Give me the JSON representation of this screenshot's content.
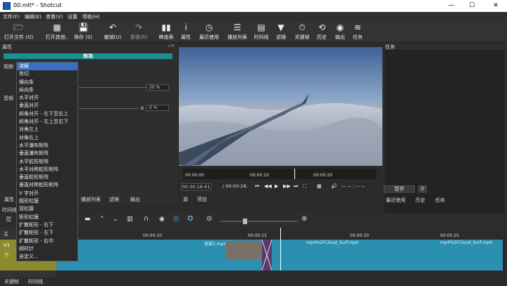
{
  "window": {
    "title": "00.mlt* - Shotcut",
    "minimize": "—",
    "maximize": "☐",
    "close": "✕"
  },
  "menu": [
    "文件(F)",
    "编辑(E)",
    "查看(V)",
    "设置",
    "帮助(H)"
  ],
  "toolbar": [
    {
      "label": "打开文件 (O)",
      "icon": "folder-open-icon",
      "glyph": "🗁"
    },
    {
      "label": "打开其他..",
      "icon": "open-other-icon",
      "glyph": "▦"
    },
    {
      "label": "保存 (S)",
      "icon": "save-icon",
      "glyph": "💾"
    },
    {
      "label": "撤销(U)",
      "icon": "undo-icon",
      "glyph": "↶"
    },
    {
      "label": "重做(R)",
      "icon": "redo-icon",
      "glyph": "↷"
    },
    {
      "label": "峰值表",
      "icon": "peak-meter-icon",
      "glyph": "▮▮"
    },
    {
      "label": "属性",
      "icon": "info-icon",
      "glyph": "ⅰ"
    },
    {
      "label": "最近使用",
      "icon": "recent-icon",
      "glyph": "◷"
    },
    {
      "label": "播放列表",
      "icon": "playlist-icon",
      "glyph": "☰"
    },
    {
      "label": "时间线",
      "icon": "timeline-icon",
      "glyph": "▤"
    },
    {
      "label": "滤镜",
      "icon": "filter-icon",
      "glyph": "▼"
    },
    {
      "label": "关键帧",
      "icon": "keyframe-icon",
      "glyph": "⏱"
    },
    {
      "label": "历史",
      "icon": "history-icon",
      "glyph": "⟲"
    },
    {
      "label": "输出",
      "icon": "export-icon",
      "glyph": "◉"
    },
    {
      "label": "任务",
      "icon": "jobs-icon",
      "glyph": "≋"
    }
  ],
  "properties": {
    "title": "属性",
    "transition": "转场",
    "video_label": "视频",
    "audio_label": "音频",
    "softness_value": "20 %",
    "mix_prefix": "B",
    "mix_value": "0 %",
    "transition_options": [
      "溶解",
      "剪切",
      "横向条",
      "纵向条",
      "水平对开",
      "垂直对开",
      "斜角对开 - 左下至右上",
      "斜角对开 - 左上至右下",
      "对角左上",
      "对角右上",
      "水平瀑布矩阵",
      "垂直瀑布矩阵",
      "水平蛇形矩阵",
      "水平对称蛇形矩阵",
      "垂直蛇形矩阵",
      "垂直对称蛇形矩阵",
      "V 字对开",
      "圆形虹膜",
      "双虹膜",
      "矩形虹膜",
      "扩散矩形 - 右下",
      "扩散矩形 - 左下",
      "扩散矩形 - 右中",
      "顺时针",
      "自定义..."
    ],
    "selected_option": "溶解"
  },
  "player": {
    "ruler": [
      "00:00:00",
      "00:00:10",
      "00:00:20"
    ],
    "position": "00:00:16:41",
    "duration": "/ 00:00:28:",
    "timecode_right": "— — : — —",
    "tab_source": "源",
    "tab_project": "项目"
  },
  "jobs": {
    "title": "任务",
    "pause": "暂停",
    "menu": "☰",
    "tabs": [
      "最近使用",
      "历史",
      "任务"
    ]
  },
  "bottom_tabs": [
    "属性",
    "播放列表",
    "滤镜",
    "输出"
  ],
  "timeline": {
    "title": "时间线",
    "ruler": [
      "00:00:10",
      "00:00:15",
      "00:00:20",
      "00:00:25"
    ],
    "track_master": "主",
    "track_v1": "V1",
    "clips": [
      "我爱2.mp4",
      "mp4%2FCloud_Surf.mp4",
      "mp4%2FCloud_Surf.mp4"
    ]
  },
  "status_tabs": [
    "关键帧",
    "时间线"
  ]
}
